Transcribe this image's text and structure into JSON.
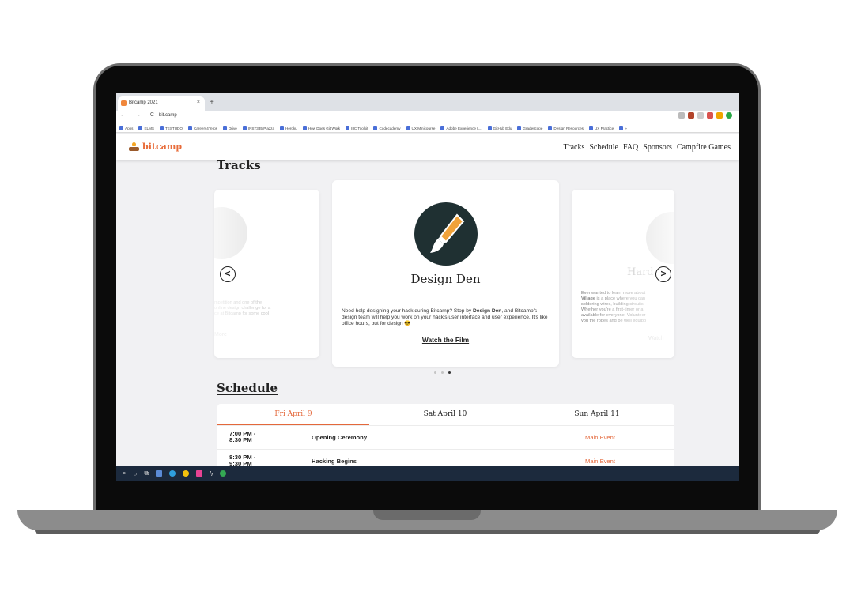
{
  "browser": {
    "tab_title": "Bitcamp 2021",
    "tab_close": "×",
    "new_tab": "+",
    "nav_buttons": "← → C",
    "url": "bit.camp",
    "bookmarks": [
      "Apps",
      "ELMS",
      "TESTUDO",
      "Careers4Terps",
      "Drive",
      "INST335 Piazza",
      "Heroku",
      "How Does Git Work",
      "IIIC Toolkit",
      "Codecademy",
      "UX Minicourse",
      "Adobe Experience L...",
      "GitHub Edu",
      "Gradescope",
      "Design Resources",
      "UX Practice",
      "»"
    ]
  },
  "site": {
    "logo_text": "bitcamp",
    "nav": [
      "Tracks",
      "Schedule",
      "FAQ",
      "Sponsors",
      "Campfire Games"
    ]
  },
  "tracks": {
    "heading": "Tracks",
    "left_card": {
      "title_fragment": "r",
      "text": "mpetition and one of the\n online design challenge for a\nce at Bitcamp for some cool",
      "link": "More"
    },
    "center_card": {
      "icon": "paintbrush-icon",
      "title": "Design Den",
      "description_prefix": "Need help designing your hack during Bitcamp? Stop by ",
      "description_bold": "Design Den",
      "description_suffix": ", and Bitcamp's design team will help you work on your hack's user interface and user experience. It's like office hours, but for design 😎",
      "link": "Watch the Film"
    },
    "right_card": {
      "title_fragment": "Hard",
      "text_prefix": "Ever wanted to learn more about",
      "text_bold": "Village",
      "text_rest": " is a place where you can\nsoldering wires, building circuits,\nWhether you're a first-timer or a\navailable for everyone! Volunteer\nyou the ropes and be well equipp",
      "link": "Watch"
    },
    "prev_arrow": "<",
    "next_arrow": ">",
    "carousel_active_index": 2,
    "carousel_count": 3
  },
  "schedule": {
    "heading": "Schedule",
    "tabs": [
      {
        "label": "Fri April 9",
        "active": true
      },
      {
        "label": "Sat April 10",
        "active": false
      },
      {
        "label": "Sun April 11",
        "active": false
      }
    ],
    "rows": [
      {
        "time": "7:00 PM -\n8:30 PM",
        "name": "Opening Ceremony",
        "location": "Main Event"
      },
      {
        "time": "8:30 PM -\n9:30 PM",
        "name": "Hacking Begins",
        "location": "Main Event"
      }
    ]
  },
  "colors": {
    "accent": "#e4683b",
    "brush_circle": "#1f3032",
    "taskbar": "#1c2a3d"
  }
}
